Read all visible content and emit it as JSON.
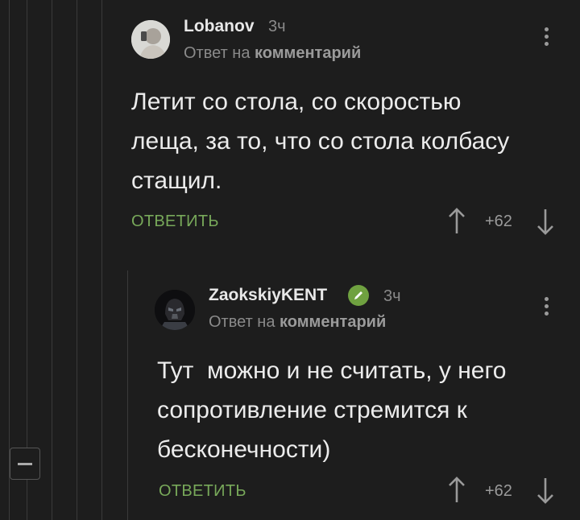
{
  "comment1": {
    "author": "Lobanov",
    "time": "3ч",
    "reply_prefix": "Ответ на",
    "reply_target": "комментарий",
    "text_lines": [
      "Летит со стола, со скоростью",
      "леща, за то, что со стола колбасу",
      "стащил."
    ],
    "reply_label": "ОТВЕТИТЬ",
    "score": "+62",
    "avatar_icon": "user-photo-avatar"
  },
  "comment2": {
    "author": "ZaokskiyKENT",
    "time": "3ч",
    "reply_prefix": "Ответ на",
    "reply_target": "комментарий",
    "text_lines": [
      "Тут  можно и не считать, у него",
      "сопротивление стремится к",
      "бесконечности)"
    ],
    "reply_label": "ОТВЕТИТЬ",
    "score": "+62",
    "avatar_icon": "darth-vader-avatar",
    "badge_icon": "pencil-icon"
  },
  "colors": {
    "background": "#1d1d1d",
    "reply_accent": "#78a95a",
    "badge_green": "#6fa140"
  }
}
